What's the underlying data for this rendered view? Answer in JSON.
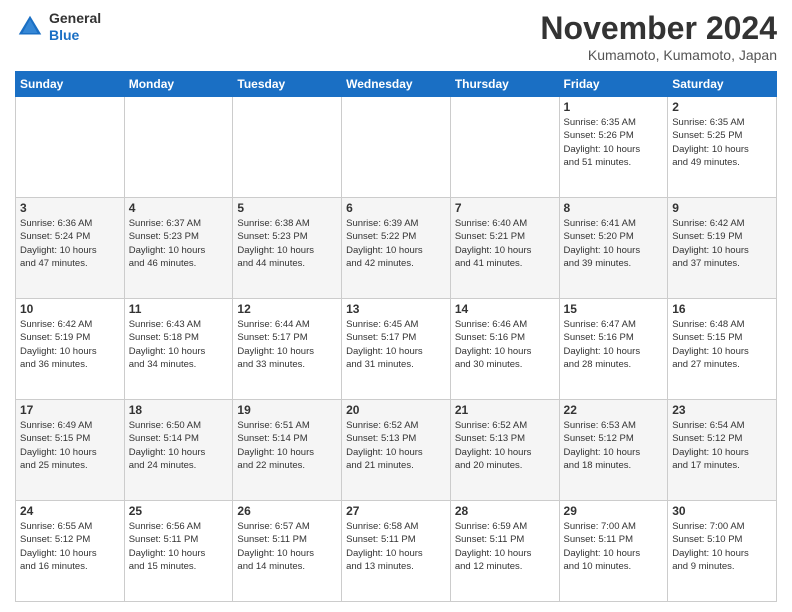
{
  "header": {
    "logo_general": "General",
    "logo_blue": "Blue",
    "title": "November 2024",
    "location": "Kumamoto, Kumamoto, Japan"
  },
  "days_of_week": [
    "Sunday",
    "Monday",
    "Tuesday",
    "Wednesday",
    "Thursday",
    "Friday",
    "Saturday"
  ],
  "weeks": [
    [
      {
        "day": "",
        "text": ""
      },
      {
        "day": "",
        "text": ""
      },
      {
        "day": "",
        "text": ""
      },
      {
        "day": "",
        "text": ""
      },
      {
        "day": "",
        "text": ""
      },
      {
        "day": "1",
        "text": "Sunrise: 6:35 AM\nSunset: 5:26 PM\nDaylight: 10 hours\nand 51 minutes."
      },
      {
        "day": "2",
        "text": "Sunrise: 6:35 AM\nSunset: 5:25 PM\nDaylight: 10 hours\nand 49 minutes."
      }
    ],
    [
      {
        "day": "3",
        "text": "Sunrise: 6:36 AM\nSunset: 5:24 PM\nDaylight: 10 hours\nand 47 minutes."
      },
      {
        "day": "4",
        "text": "Sunrise: 6:37 AM\nSunset: 5:23 PM\nDaylight: 10 hours\nand 46 minutes."
      },
      {
        "day": "5",
        "text": "Sunrise: 6:38 AM\nSunset: 5:23 PM\nDaylight: 10 hours\nand 44 minutes."
      },
      {
        "day": "6",
        "text": "Sunrise: 6:39 AM\nSunset: 5:22 PM\nDaylight: 10 hours\nand 42 minutes."
      },
      {
        "day": "7",
        "text": "Sunrise: 6:40 AM\nSunset: 5:21 PM\nDaylight: 10 hours\nand 41 minutes."
      },
      {
        "day": "8",
        "text": "Sunrise: 6:41 AM\nSunset: 5:20 PM\nDaylight: 10 hours\nand 39 minutes."
      },
      {
        "day": "9",
        "text": "Sunrise: 6:42 AM\nSunset: 5:19 PM\nDaylight: 10 hours\nand 37 minutes."
      }
    ],
    [
      {
        "day": "10",
        "text": "Sunrise: 6:42 AM\nSunset: 5:19 PM\nDaylight: 10 hours\nand 36 minutes."
      },
      {
        "day": "11",
        "text": "Sunrise: 6:43 AM\nSunset: 5:18 PM\nDaylight: 10 hours\nand 34 minutes."
      },
      {
        "day": "12",
        "text": "Sunrise: 6:44 AM\nSunset: 5:17 PM\nDaylight: 10 hours\nand 33 minutes."
      },
      {
        "day": "13",
        "text": "Sunrise: 6:45 AM\nSunset: 5:17 PM\nDaylight: 10 hours\nand 31 minutes."
      },
      {
        "day": "14",
        "text": "Sunrise: 6:46 AM\nSunset: 5:16 PM\nDaylight: 10 hours\nand 30 minutes."
      },
      {
        "day": "15",
        "text": "Sunrise: 6:47 AM\nSunset: 5:16 PM\nDaylight: 10 hours\nand 28 minutes."
      },
      {
        "day": "16",
        "text": "Sunrise: 6:48 AM\nSunset: 5:15 PM\nDaylight: 10 hours\nand 27 minutes."
      }
    ],
    [
      {
        "day": "17",
        "text": "Sunrise: 6:49 AM\nSunset: 5:15 PM\nDaylight: 10 hours\nand 25 minutes."
      },
      {
        "day": "18",
        "text": "Sunrise: 6:50 AM\nSunset: 5:14 PM\nDaylight: 10 hours\nand 24 minutes."
      },
      {
        "day": "19",
        "text": "Sunrise: 6:51 AM\nSunset: 5:14 PM\nDaylight: 10 hours\nand 22 minutes."
      },
      {
        "day": "20",
        "text": "Sunrise: 6:52 AM\nSunset: 5:13 PM\nDaylight: 10 hours\nand 21 minutes."
      },
      {
        "day": "21",
        "text": "Sunrise: 6:52 AM\nSunset: 5:13 PM\nDaylight: 10 hours\nand 20 minutes."
      },
      {
        "day": "22",
        "text": "Sunrise: 6:53 AM\nSunset: 5:12 PM\nDaylight: 10 hours\nand 18 minutes."
      },
      {
        "day": "23",
        "text": "Sunrise: 6:54 AM\nSunset: 5:12 PM\nDaylight: 10 hours\nand 17 minutes."
      }
    ],
    [
      {
        "day": "24",
        "text": "Sunrise: 6:55 AM\nSunset: 5:12 PM\nDaylight: 10 hours\nand 16 minutes."
      },
      {
        "day": "25",
        "text": "Sunrise: 6:56 AM\nSunset: 5:11 PM\nDaylight: 10 hours\nand 15 minutes."
      },
      {
        "day": "26",
        "text": "Sunrise: 6:57 AM\nSunset: 5:11 PM\nDaylight: 10 hours\nand 14 minutes."
      },
      {
        "day": "27",
        "text": "Sunrise: 6:58 AM\nSunset: 5:11 PM\nDaylight: 10 hours\nand 13 minutes."
      },
      {
        "day": "28",
        "text": "Sunrise: 6:59 AM\nSunset: 5:11 PM\nDaylight: 10 hours\nand 12 minutes."
      },
      {
        "day": "29",
        "text": "Sunrise: 7:00 AM\nSunset: 5:11 PM\nDaylight: 10 hours\nand 10 minutes."
      },
      {
        "day": "30",
        "text": "Sunrise: 7:00 AM\nSunset: 5:10 PM\nDaylight: 10 hours\nand 9 minutes."
      }
    ]
  ]
}
